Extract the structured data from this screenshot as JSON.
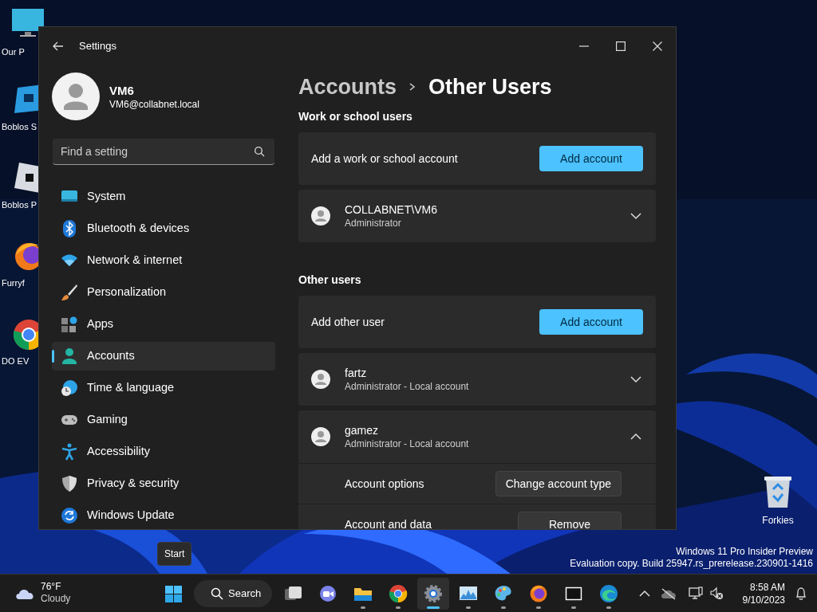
{
  "desktop": {
    "icons": [
      {
        "label": "Our P"
      },
      {
        "label": "Boblos S"
      },
      {
        "label": "Boblos P"
      },
      {
        "label": "Furryf"
      },
      {
        "label": "DO EV"
      }
    ],
    "recycle_bin": {
      "label": "Forkies"
    },
    "watermark": [
      "Windows 11 Pro Insider Preview",
      "Evaluation copy. Build 25947.rs_prerelease.230901-1416"
    ]
  },
  "window": {
    "title": "Settings",
    "profile": {
      "name": "VM6",
      "email": "VM6@collabnet.local"
    },
    "search": {
      "placeholder": "Find a setting"
    },
    "nav": [
      {
        "label": "System",
        "selected": false
      },
      {
        "label": "Bluetooth & devices",
        "selected": false
      },
      {
        "label": "Network & internet",
        "selected": false
      },
      {
        "label": "Personalization",
        "selected": false
      },
      {
        "label": "Apps",
        "selected": false
      },
      {
        "label": "Accounts",
        "selected": true
      },
      {
        "label": "Time & language",
        "selected": false
      },
      {
        "label": "Gaming",
        "selected": false
      },
      {
        "label": "Accessibility",
        "selected": false
      },
      {
        "label": "Privacy & security",
        "selected": false
      },
      {
        "label": "Windows Update",
        "selected": false
      }
    ],
    "breadcrumb": [
      "Accounts",
      "Other Users"
    ],
    "sections": [
      {
        "heading": "Work or school users",
        "rows": [
          {
            "kind": "action",
            "label": "Add a work or school account",
            "button": "Add account"
          },
          {
            "kind": "user",
            "name": "COLLABNET\\VM6",
            "role": "Administrator",
            "expanded": false
          }
        ]
      },
      {
        "heading": "Other users",
        "rows": [
          {
            "kind": "action",
            "label": "Add other user",
            "button": "Add account"
          },
          {
            "kind": "user",
            "name": "fartz",
            "role": "Administrator - Local account",
            "expanded": false
          },
          {
            "kind": "user",
            "name": "gamez",
            "role": "Administrator - Local account",
            "expanded": true,
            "options": [
              {
                "label": "Account options",
                "button": "Change account type"
              },
              {
                "label": "Account and data",
                "button": "Remove"
              }
            ]
          }
        ]
      }
    ]
  },
  "tooltip": "Start",
  "taskbar": {
    "weather": {
      "temp": "76°F",
      "condition": "Cloudy"
    },
    "apps": [
      {
        "kind": "start",
        "running": false,
        "active": false
      },
      {
        "kind": "search",
        "label": "Search"
      },
      {
        "kind": "taskview",
        "running": false,
        "active": false
      },
      {
        "kind": "chat",
        "running": false,
        "active": false
      },
      {
        "kind": "explorer",
        "running": true,
        "active": false
      },
      {
        "kind": "chrome",
        "running": true,
        "active": false
      },
      {
        "kind": "settings",
        "running": true,
        "active": true
      },
      {
        "kind": "monitor",
        "running": true,
        "active": false
      },
      {
        "kind": "paint",
        "running": true,
        "active": false
      },
      {
        "kind": "firefox",
        "running": true,
        "active": false
      },
      {
        "kind": "archiver",
        "running": true,
        "active": false
      },
      {
        "kind": "edge",
        "running": true,
        "active": false
      }
    ],
    "clock": {
      "time": "8:58 AM",
      "date": "9/10/2023"
    }
  }
}
